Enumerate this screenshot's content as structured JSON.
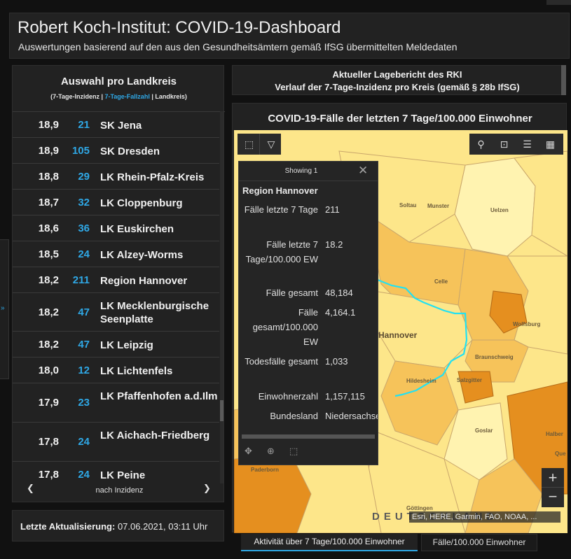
{
  "header": {
    "title": "Robert Koch-Institut: COVID-19-Dashboard",
    "subtitle": "Auswertungen basierend auf den aus den Gesundheitsämtern gemäß IfSG übermittelten Meldedaten"
  },
  "side_handle_icon": "»",
  "list": {
    "title": "Auswahl pro Landkreis",
    "legend_a": "(7-Tage-Inzidenz | ",
    "legend_b": "7-Tage-Fallzahl",
    "legend_c": " | Landkreis)",
    "prev_icon": "❮",
    "next_icon": "❯",
    "sort_label": "nach Inzidenz",
    "rows": [
      {
        "inz": "18,9",
        "cnt": "21",
        "name": "SK Jena"
      },
      {
        "inz": "18,9",
        "cnt": "105",
        "name": "SK Dresden"
      },
      {
        "inz": "18,8",
        "cnt": "29",
        "name": "LK Rhein-Pfalz-Kreis"
      },
      {
        "inz": "18,7",
        "cnt": "32",
        "name": "LK Cloppenburg"
      },
      {
        "inz": "18,6",
        "cnt": "36",
        "name": "LK Euskirchen"
      },
      {
        "inz": "18,5",
        "cnt": "24",
        "name": "LK Alzey-Worms"
      },
      {
        "inz": "18,2",
        "cnt": "211",
        "name": "Region Hannover"
      },
      {
        "inz": "18,2",
        "cnt": "47",
        "name": "LK Mecklenburgische Seenplatte"
      },
      {
        "inz": "18,2",
        "cnt": "47",
        "name": "LK Leipzig"
      },
      {
        "inz": "18,0",
        "cnt": "12",
        "name": "LK Lichtenfels"
      },
      {
        "inz": "17,9",
        "cnt": "23",
        "name": "LK Pfaffenhofen a.d.Ilm"
      },
      {
        "inz": "17,8",
        "cnt": "24",
        "name": "LK Aichach-Friedberg"
      },
      {
        "inz": "17,8",
        "cnt": "24",
        "name": "LK Peine"
      }
    ]
  },
  "update": {
    "label": "Letzte Aktualisierung:",
    "value": " 07.06.2021, 03:11 Uhr"
  },
  "report": {
    "line1": "Aktueller Lagebericht des RKI",
    "line2": "Verlauf der 7-Tage-Inzidenz pro Kreis (gemäß § 28b IfSG)"
  },
  "map": {
    "title": "COVID-19-Fälle der letzten 7 Tage/100.000 Einwohner",
    "towns": [
      "Soltau",
      "Munster",
      "Uelzen",
      "Celle",
      "Hannover",
      "Wolfsburg",
      "Braunschweig",
      "Hildesheim",
      "Salzgitter",
      "Goslar",
      "Paderborn",
      "Halber",
      "Que",
      "Göttingen"
    ],
    "colors": {
      "light": "#fff3b0",
      "pale": "#fde68a",
      "mid": "#f6c35a",
      "dark": "#e58f1f",
      "deep": "#d2741a",
      "river": "#22e1f2"
    },
    "tools": {
      "select_icon": "⬚",
      "dropdown_icon": "▽",
      "search_icon": "⚲",
      "bookmark_icon": "⊡",
      "list_icon": "☰",
      "qr_icon": "▦",
      "zoom_in": "+",
      "zoom_out": "−"
    },
    "attribution": "Esri, HERE, Garmin, FAO, NOAA, ...",
    "watermark": "DEUTSCHLAND"
  },
  "popup": {
    "showing": "Showing 1",
    "close_icon": "✕",
    "title": "Region Hannover",
    "fields": [
      {
        "label": "Fälle letzte 7 Tage",
        "value": "211"
      },
      {
        "label": "Fälle letzte 7 Tage/100.000 EW",
        "value": "18.2"
      },
      {
        "label": "Fälle gesamt",
        "value": "48,184"
      },
      {
        "label": "Fälle gesamt/100.000 EW",
        "value": "4,164.1"
      },
      {
        "label": "Todesfälle gesamt",
        "value": "1,033"
      },
      {
        "label": "Einwohnerzahl",
        "value": "1,157,115"
      },
      {
        "label": "Bundesland",
        "value": "Niedersachsen"
      }
    ],
    "footer_icons": {
      "move": "✥",
      "zoom": "⊕",
      "select": "⬚"
    }
  },
  "tabs": [
    {
      "label": "Aktivität über 7 Tage/100.000 Einwohner",
      "active": true
    },
    {
      "label": "Fälle/100.000 Einwohner",
      "active": false
    }
  ]
}
